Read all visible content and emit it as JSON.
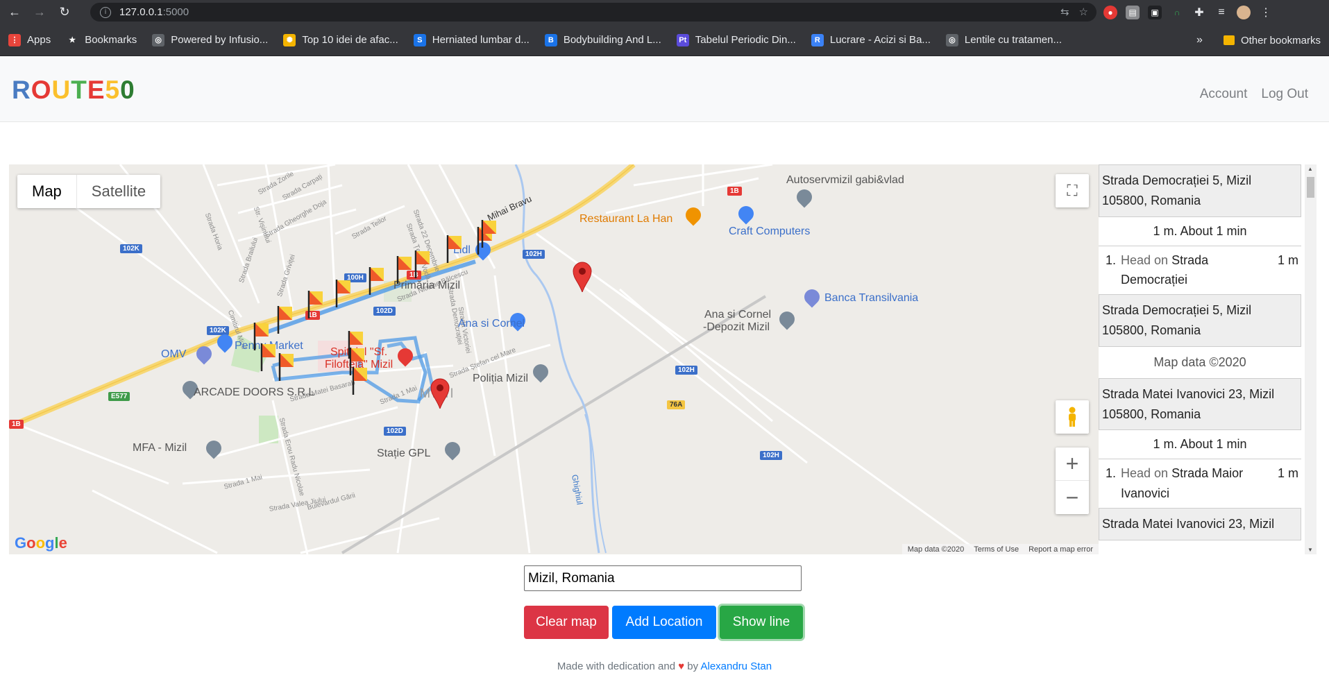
{
  "browser": {
    "url_host": "127.0.0.1",
    "url_port": ":5000",
    "bookmarks": [
      {
        "label": "Apps",
        "color": "#e8453c",
        "glyph": "⋮"
      },
      {
        "label": "Bookmarks",
        "color": "#35363a",
        "glyph": "★"
      },
      {
        "label": "Powered by Infusio...",
        "color": "#5f6368",
        "glyph": "◎"
      },
      {
        "label": "Top 10 idei de afac...",
        "color": "#f4b400",
        "glyph": "✺"
      },
      {
        "label": "Herniated lumbar d...",
        "color": "#1a73e8",
        "glyph": "S"
      },
      {
        "label": "Bodybuilding And L...",
        "color": "#1a73e8",
        "glyph": "B"
      },
      {
        "label": "Tabelul Periodic Din...",
        "color": "#5b4cdb",
        "glyph": "Pt"
      },
      {
        "label": "Lucrare - Acizi si Ba...",
        "color": "#3b82f6",
        "glyph": "R"
      },
      {
        "label": "Lentile cu tratamen...",
        "color": "#5f6368",
        "glyph": "◎"
      }
    ],
    "overflow": "»",
    "other_bookmarks": "Other bookmarks"
  },
  "navbar": {
    "brand_letters": [
      {
        "ch": "R",
        "color": "#4a7cc2"
      },
      {
        "ch": "O",
        "color": "#e53935"
      },
      {
        "ch": "U",
        "color": "#fbc02d"
      },
      {
        "ch": "T",
        "color": "#4caf50"
      },
      {
        "ch": "E",
        "color": "#e53935"
      },
      {
        "ch": "5",
        "color": "#fbc02d"
      },
      {
        "ch": "0",
        "color": "#2e7d32"
      }
    ],
    "account": "Account",
    "logout": "Log Out"
  },
  "map": {
    "type_map": "Map",
    "type_satellite": "Satellite",
    "places": {
      "restaurant": "Restaurant La Han",
      "craft": "Craft Computers",
      "autoservice": "Autoservmizil gabi&vlad",
      "lidl": "Lidl",
      "primaria": "Primăria Mizil",
      "banca": "Banca Transilvania",
      "ana1": "Ana si Cornel",
      "ana2a": "Ana si Cornel",
      "ana2b": "-Depozit Mizil",
      "penny": "Penny Market",
      "omv": "OMV",
      "spital": "Spitalul \"Sf.",
      "spital2": "Filofteia\" Mizil",
      "politia": "Poliția Mizil",
      "arcade": "ARCADE DOORS S.R.L",
      "mfa": "MFA - Mizil",
      "statie": "Stație GPL",
      "mizil": "Mizil",
      "mihai": "Mihai Bravu",
      "ghighiul": "Ghighiul"
    },
    "streets": {
      "zorile": "Strada Zorile",
      "carpati": "Strada Carpați",
      "visinului": "Str. Vișinului",
      "gheorghe": "Strada Gheorghe Doja",
      "teilor": "Strada Teilor",
      "horia": "Strada Horia",
      "brailului": "Strada Brailului",
      "grivitei": "Strada Griviței",
      "cimitirul": "Cimitirul Mizil",
      "nicolae": "Strada Nicolae Bălcescu",
      "democratiei": "Strada Democrației",
      "victoriei": "Strada Victoriei",
      "stefan": "Strada Ștefan cel Mare",
      "matei": "Strada Matei Basarab",
      "erou": "Strada Erou Radu Nicolae",
      "unmai": "Strada 1 Mai",
      "unmai2": "Strada 1 Mai",
      "valea": "Strada Valea Jiului",
      "garii": "Bulevardul Gării",
      "unu22": "Strada 22 Decembrie",
      "tepes": "Strada Țepeș Vodă"
    },
    "shields": {
      "s102k_1": "102K",
      "s102k_2": "102K",
      "s100h": "100H",
      "s102d_1": "102D",
      "s102d_2": "102D",
      "s102h_1": "102H",
      "s102h_2": "102H",
      "s102h_3": "102H",
      "s1b_1": "1B",
      "s1b_2": "1B",
      "s1b_3": "1B",
      "s1b_4": "1B",
      "e577": "E577",
      "s76a": "76A"
    },
    "footer_data": "Map data ©2020",
    "footer_terms": "Terms of Use",
    "footer_report": "Report a map error",
    "google": [
      {
        "ch": "G",
        "color": "#4285f4"
      },
      {
        "ch": "o",
        "color": "#ea4335"
      },
      {
        "ch": "o",
        "color": "#fbbc05"
      },
      {
        "ch": "g",
        "color": "#4285f4"
      },
      {
        "ch": "l",
        "color": "#34a853"
      },
      {
        "ch": "e",
        "color": "#ea4335"
      }
    ]
  },
  "directions": {
    "addr1": "Strada Democrației 5, Mizil 105800, Romania",
    "summary1": "1 m. About 1 min",
    "step1_num": "1.",
    "step1_pre": "Head",
    "step1_on": " on ",
    "step1_street": "Strada Democrației",
    "step1_dist": "1 m",
    "addr2": "Strada Democrației 5, Mizil 105800, Romania",
    "mapdata": "Map data ©2020",
    "addr3": "Strada Matei Ivanovici 23, Mizil 105800, Romania",
    "summary2": "1 m. About 1 min",
    "step2_num": "1.",
    "step2_pre": "Head",
    "step2_on": " on ",
    "step2_street": "Strada Maior Ivanovici",
    "step2_dist": "1 m",
    "addr4": "Strada Matei Ivanovici 23, Mizil"
  },
  "form": {
    "location_value": "Mizil, Romania",
    "clear": "Clear map",
    "add": "Add Location",
    "show": "Show line"
  },
  "footer": {
    "pre": "Made with dedication and",
    "by": "by",
    "author": "Alexandru Stan"
  }
}
